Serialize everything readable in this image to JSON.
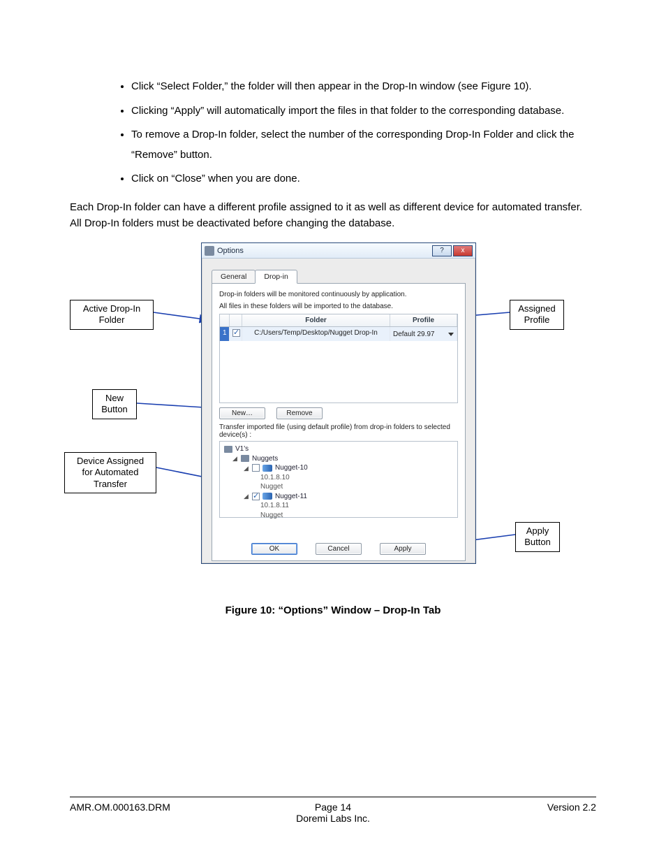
{
  "bullets": [
    "Click “Select Folder,” the folder will then appear in the Drop-In window (see Figure 10).",
    "Clicking “Apply” will automatically import the files in that folder to the corresponding database.",
    "To remove a Drop-In folder, select the number of the corresponding Drop-In Folder and click the “Remove” button.",
    "Click on “Close” when you are done."
  ],
  "paragraph": "Each Drop-In folder can have a different profile assigned to it as well as different device for automated transfer.  All Drop-In folders must be deactivated before changing the database.",
  "callouts": {
    "active": "Active Drop-In\nFolder",
    "new": "New\nButton",
    "device": "Device Assigned\nfor Automated\nTransfer",
    "assigned": "Assigned\nProfile",
    "apply": "Apply\nButton"
  },
  "dialog": {
    "title": "Options",
    "help": "?",
    "close": "x",
    "tabs": {
      "general": "General",
      "dropin": "Drop-in"
    },
    "hint1": "Drop-in folders will be monitored continuously by application.",
    "hint2": "All files in these folders will be imported to the database.",
    "headers": {
      "folder": "Folder",
      "profile": "Profile"
    },
    "row": {
      "num": "1",
      "folder": "C:/Users/Temp/Desktop/Nugget Drop-In",
      "profile": "Default 29.97"
    },
    "buttons": {
      "new": "New…",
      "remove": "Remove",
      "ok": "OK",
      "cancel": "Cancel",
      "apply": "Apply"
    },
    "transferLabel": "Transfer imported file (using default profile) from drop-in folders to selected device(s) :",
    "tree": {
      "root": "V1's",
      "group": "Nuggets",
      "dev1": {
        "name": "Nugget-10",
        "ip": "10.1.8.10",
        "type": "Nugget"
      },
      "dev2": {
        "name": "Nugget-11",
        "ip": "10.1.8.11",
        "type": "Nugget"
      }
    }
  },
  "caption": "Figure 10: “Options” Window – Drop-In Tab",
  "footer": {
    "left": "AMR.OM.000163.DRM",
    "page": "Page 14",
    "company": "Doremi Labs Inc.",
    "version": "Version 2.2"
  }
}
